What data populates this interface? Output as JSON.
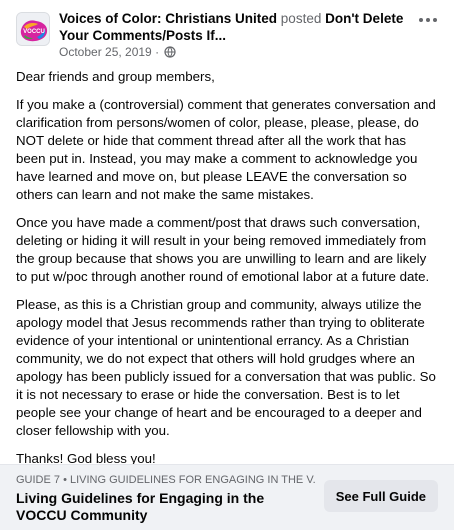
{
  "post": {
    "group_name": "Voices of Color: Christians United",
    "action": "posted",
    "post_title": "Don't Delete Your Comments/Posts If...",
    "date": "October 25, 2019",
    "separator": "·",
    "avatar_icon": "group-logo-icon",
    "privacy_icon": "globe-icon",
    "more_icon": "more-options-icon"
  },
  "body": {
    "paragraphs": [
      "Dear friends and group members,",
      "If you make a (controversial) comment that generates conversation and clarification from persons/women of color, please, please, please, do NOT delete or hide that comment thread after all the work that has been put in. Instead, you may make a comment to acknowledge you have learned and move on, but please LEAVE the conversation so others can learn and not make the same mistakes.",
      "Once you have made a comment/post that draws such conversation, deleting or hiding it will result in your being removed immediately from the group because that shows you are unwilling to learn and are likely to put w/poc through another round of emotional labor at a future date.",
      "Please, as this is a Christian group and community, always utilize the apology model that Jesus recommends rather than trying to obliterate evidence of your intentional or unintentional errancy. As a Christian community, we do not expect that others will hold grudges where an apology has been publicly issued for a conversation that was public. So it is not necessary to erase or hide the conversation. Best is to let people see your change of heart and be encouraged to a deeper and closer fellowship with you.",
      "Thanks! God bless you!"
    ]
  },
  "guide": {
    "kicker": "GUIDE 7 • LIVING GUIDELINES FOR ENGAGING IN THE V...",
    "title": "Living Guidelines for Engaging in the VOCCU Community",
    "button_label": "See Full Guide"
  },
  "colors": {
    "secondary_text": "#65676b",
    "footer_bg": "#f0f2f5",
    "button_bg": "#e4e6eb"
  }
}
